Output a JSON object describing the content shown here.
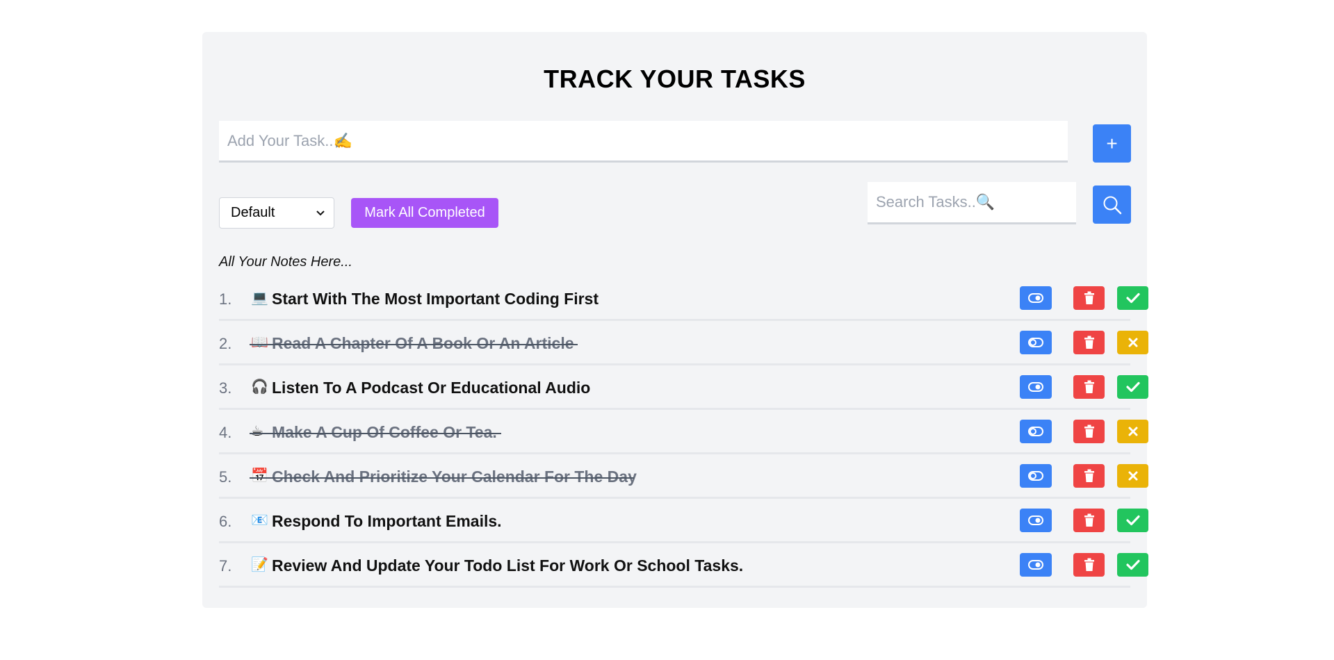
{
  "header": {
    "title": "TRACK YOUR TASKS"
  },
  "add_task": {
    "placeholder": "Add Your Task..✍️",
    "button_label": "+"
  },
  "filter": {
    "selected": "Default"
  },
  "mark_all_label": "Mark All Completed",
  "search": {
    "placeholder": "Search Tasks..🔍"
  },
  "notes_label": "All Your Notes Here...",
  "tasks": [
    {
      "number": "1.",
      "emoji": "💻",
      "text": "Start With The Most Important Coding First",
      "completed": false
    },
    {
      "number": "2.",
      "emoji": "📖",
      "text": "Read A Chapter Of A Book Or An Article",
      "completed": true
    },
    {
      "number": "3.",
      "emoji": "🎧",
      "text": "Listen To A Podcast Or Educational Audio",
      "completed": false
    },
    {
      "number": "4.",
      "emoji": "☕",
      "text": "Make A Cup Of Coffee Or Tea.",
      "completed": true
    },
    {
      "number": "5.",
      "emoji": "📅",
      "text": "Check And Prioritize Your Calendar For The Day",
      "completed": true
    },
    {
      "number": "6.",
      "emoji": "📧",
      "text": "Respond To Important Emails.",
      "completed": false
    },
    {
      "number": "7.",
      "emoji": "📝",
      "text": "Review And Update Your Todo List For Work Or School Tasks.",
      "completed": false
    }
  ],
  "colors": {
    "primary": "#3b82f6",
    "danger": "#ef4444",
    "success": "#22c55e",
    "warning": "#eab308",
    "purple": "#a855f7"
  }
}
